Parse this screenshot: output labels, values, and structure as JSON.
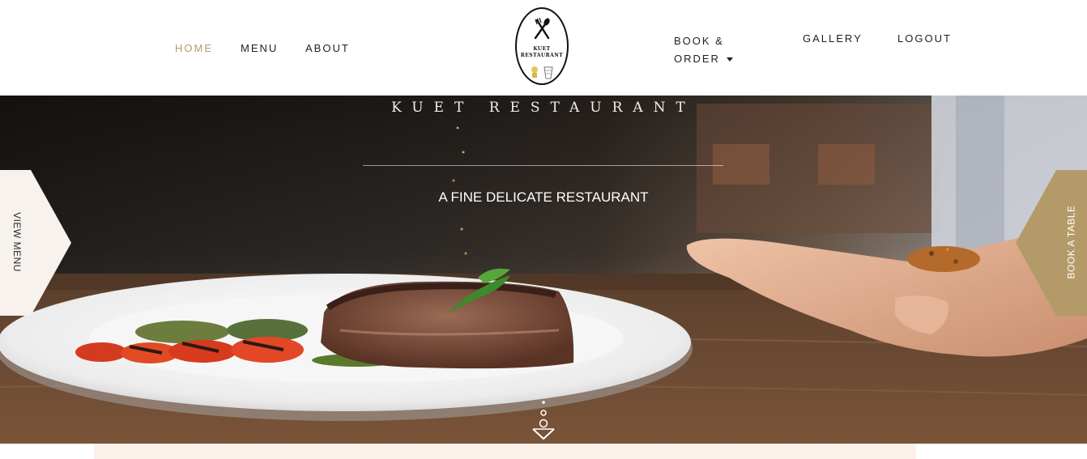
{
  "nav": {
    "home": "HOME",
    "menu": "MENU",
    "about": "ABOUT",
    "book_line1": "BOOK &",
    "book_line2": "ORDER",
    "gallery": "GALLERY",
    "logout": "LOGOUT",
    "active_color": "#b49a68"
  },
  "logo": {
    "line1": "KUET",
    "line2": "RESTAURANT",
    "icon": "fork-spoon-icon"
  },
  "hero": {
    "title": "KUET RESTAURANT",
    "subtitle": "A FINE DELICATE RESTAURANT",
    "left_tab": "VIEW MENU",
    "right_tab": "BOOK A TABLE",
    "right_tab_color": "#b49a68",
    "left_tab_color": "#f7f2ee",
    "scroll_icon": "scroll-down-icon"
  }
}
